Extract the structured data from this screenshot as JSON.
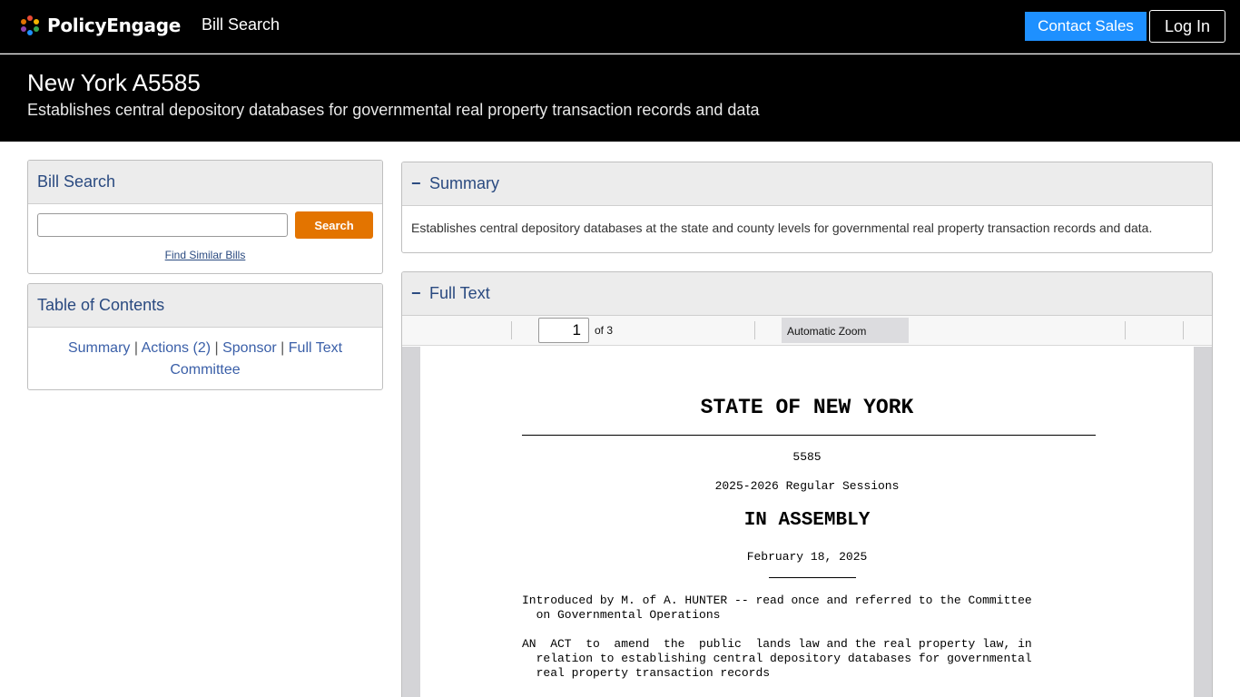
{
  "nav": {
    "logo_text": "PolicyEngage",
    "bill_search_link": "Bill Search",
    "contact_sales": "Contact Sales",
    "login": "Log In",
    "logo_dot_colors": [
      "#e94b35",
      "#f4b400",
      "#1e90ff",
      "#34a853",
      "#8e44ad",
      "#e37400"
    ]
  },
  "header": {
    "title": "New York A5585",
    "subtitle": "Establishes central depository databases for governmental real property transaction records and data"
  },
  "search_panel": {
    "title": "Bill Search",
    "input_value": "",
    "button_label": "Search",
    "similar_link": "Find Similar Bills"
  },
  "toc": {
    "title": "Table of Contents",
    "items": [
      "Summary",
      "Actions (2)",
      "Sponsor",
      "Full Text",
      "Committee"
    ],
    "separator": "|"
  },
  "summary": {
    "toggle": "−",
    "title": "Summary",
    "text": "Establishes central depository databases at the state and county levels for governmental real property transaction records and data."
  },
  "full_text": {
    "toggle": "−",
    "title": "Full Text",
    "toolbar": {
      "page_number": "1",
      "page_of": "of 3",
      "zoom": "Automatic Zoom"
    },
    "document": {
      "state": "STATE OF NEW YORK",
      "bill_number": "5585",
      "session": "2025-2026 Regular Sessions",
      "chamber": "IN ASSEMBLY",
      "date": "February 18, 2025",
      "introduced": "Introduced by M. of A. HUNTER -- read once and referred to the Committee\n  on Governmental Operations",
      "act": "AN  ACT  to  amend  the  public  lands law and the real property law, in\n  relation to establishing central depository databases for governmental\n  real property transaction records"
    }
  },
  "colors": {
    "nav_bg": "#000000",
    "contact_button": "#1e90ff",
    "search_button": "#e37400",
    "link": "#3a5fa8",
    "panel_header": "#ececec"
  }
}
